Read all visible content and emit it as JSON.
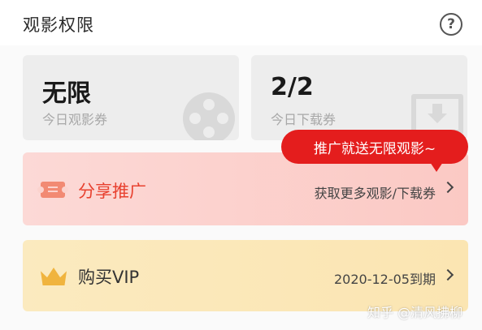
{
  "header": {
    "title": "观影权限",
    "help_icon": "question-circle-icon"
  },
  "stats": [
    {
      "value": "无限",
      "label": "今日观影券",
      "icon": "film-reel-icon"
    },
    {
      "value": "2/2",
      "label": "今日下载券",
      "icon": "download-icon"
    }
  ],
  "promo": {
    "label": "分享推广",
    "sub_label": "获取更多观影/下载券",
    "icon": "ticket-icon",
    "tooltip": "推广就送无限观影~",
    "tooltip_color": "#e41d1d"
  },
  "vip": {
    "label": "购买VIP",
    "expiry": "2020-12-05到期",
    "icon": "crown-icon"
  },
  "watermark": "知乎 @清风拂柳",
  "colors": {
    "accent_red": "#e8412f",
    "promo_bg": "#fbc9c4",
    "vip_bg": "#fbe5b2",
    "crown": "#f0b43e"
  }
}
